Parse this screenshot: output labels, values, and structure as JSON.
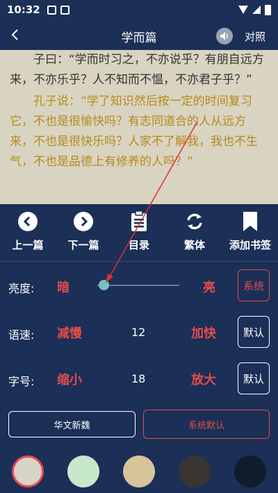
{
  "status_bar": {
    "time": "10:32"
  },
  "header": {
    "title": "学而篇",
    "compare_label": "对照"
  },
  "reading": {
    "original": "子曰：“学而时习之，不亦说乎？有朋自远方来，不亦乐乎？人不知而不愠，不亦君子乎？”",
    "translation": "孔子说：“学了知识然后按一定的时间复习它，不也是很愉快吗？有志同道合的人从远方来，不也是很快乐吗？人家不了解我，我也不生气，不也是品德上有修养的人吗？”"
  },
  "toolbar": {
    "prev": "上一篇",
    "next": "下一篇",
    "catalog": "目录",
    "traditional": "繁体",
    "bookmark": "添加书签"
  },
  "brightness": {
    "label": "亮度:",
    "dark": "暗",
    "bright": "亮",
    "system": "系统",
    "level": 0.08
  },
  "speed": {
    "label": "语速:",
    "slower": "减慢",
    "value": "12",
    "faster": "加快",
    "default": "默认"
  },
  "fontsize": {
    "label": "字号:",
    "smaller": "缩小",
    "value": "18",
    "larger": "放大",
    "default": "默认"
  },
  "buttons": {
    "font_name": "华文新魏",
    "system_default": "系统默认"
  },
  "colors": {
    "accent_red": "#e54b4b",
    "swatches": [
      "#d9d4c8",
      "#c8e8cc",
      "#d8c49a",
      "#3a3532",
      "#0f1d2e"
    ]
  }
}
